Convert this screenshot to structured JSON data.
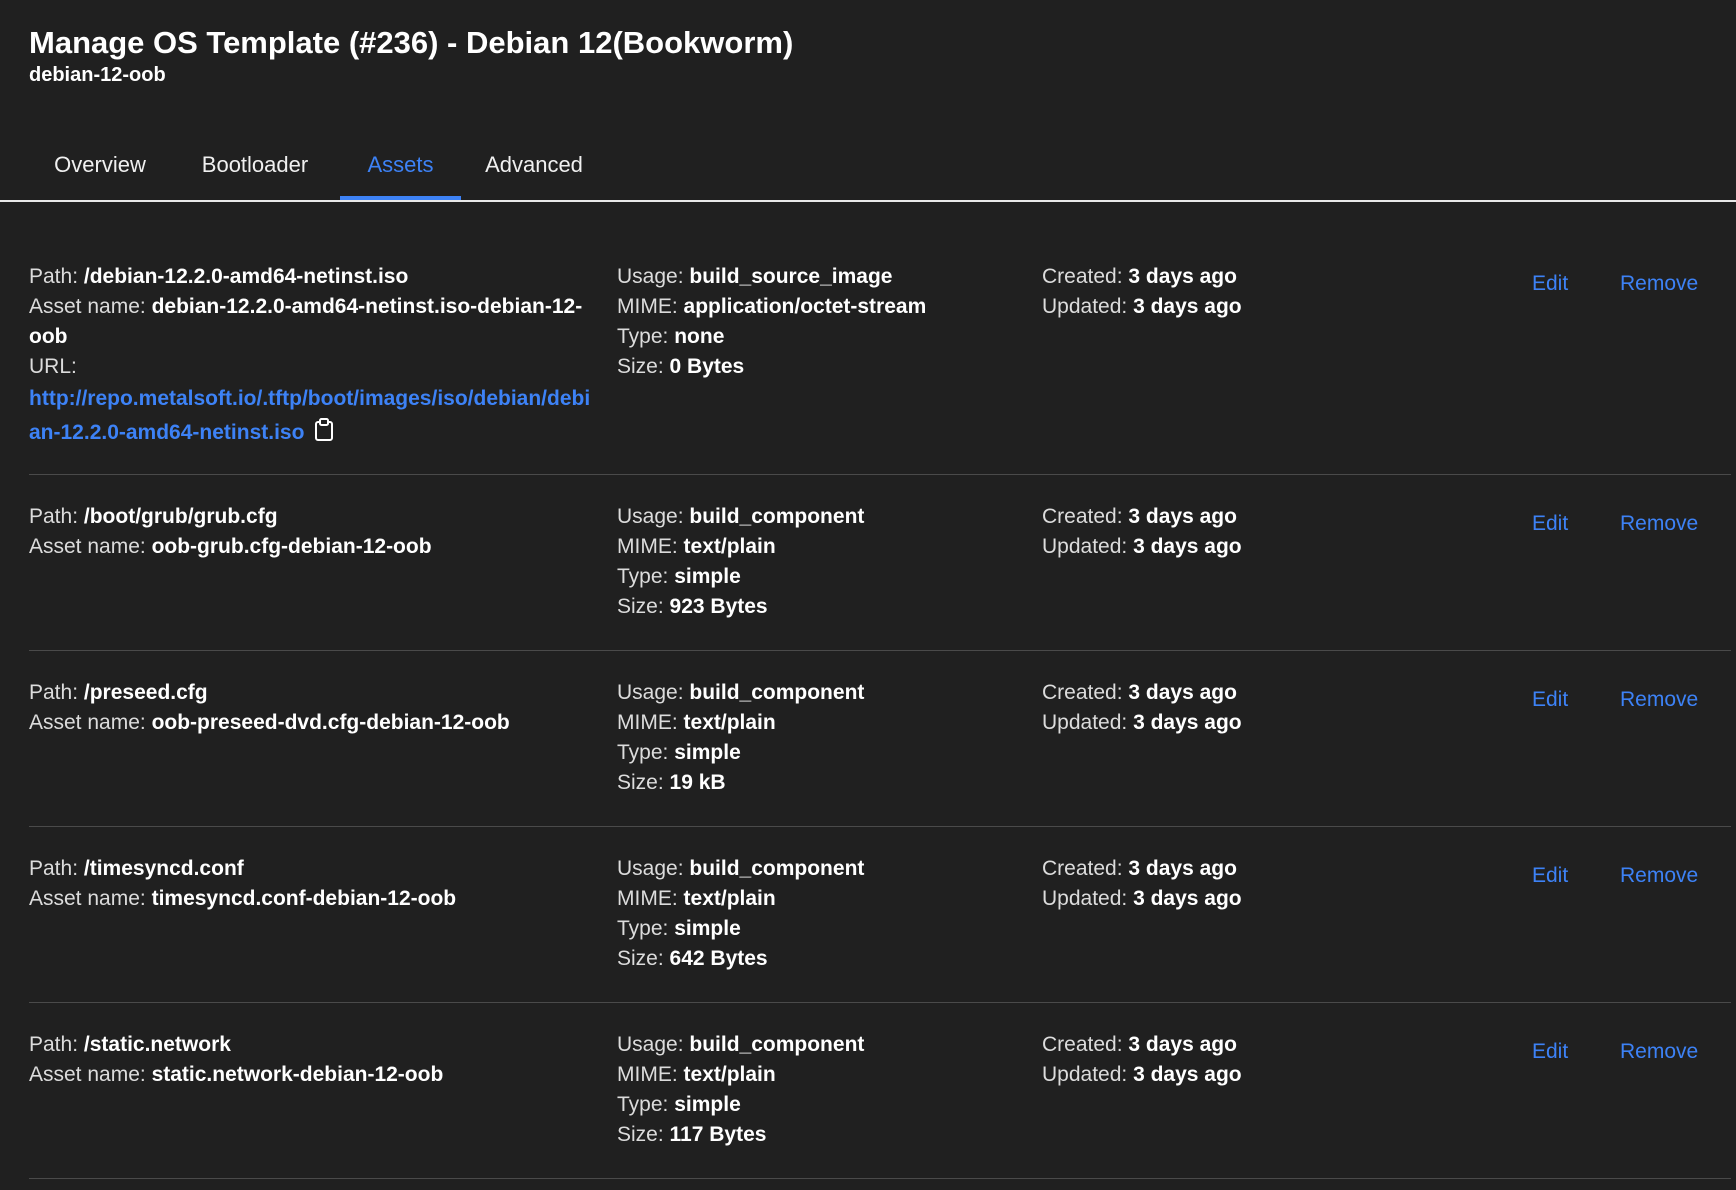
{
  "header": {
    "title": "Manage OS Template (#236) - Debian 12(Bookworm)",
    "subtitle": "debian-12-oob"
  },
  "tabs": [
    {
      "label": "Overview",
      "active": false
    },
    {
      "label": "Bootloader",
      "active": false
    },
    {
      "label": "Assets",
      "active": true
    },
    {
      "label": "Advanced",
      "active": false
    }
  ],
  "labels": {
    "path": "Path:",
    "asset_name": "Asset name:",
    "url": "URL:",
    "usage": "Usage:",
    "mime": "MIME:",
    "type": "Type:",
    "size": "Size:",
    "created": "Created:",
    "updated": "Updated:",
    "edit": "Edit",
    "remove": "Remove"
  },
  "assets": [
    {
      "path": "/debian-12.2.0-amd64-netinst.iso",
      "asset_name": "debian-12.2.0-amd64-netinst.iso-debian-12-oob",
      "url": "http://repo.metalsoft.io/.tftp/boot/images/iso/debian/debian-12.2.0-amd64-netinst.iso",
      "usage": "build_source_image",
      "mime": "application/octet-stream",
      "type": "none",
      "size": "0 Bytes",
      "created": "3 days ago",
      "updated": "3 days ago"
    },
    {
      "path": "/boot/grub/grub.cfg",
      "asset_name": "oob-grub.cfg-debian-12-oob",
      "usage": "build_component",
      "mime": "text/plain",
      "type": "simple",
      "size": "923 Bytes",
      "created": "3 days ago",
      "updated": "3 days ago"
    },
    {
      "path": "/preseed.cfg",
      "asset_name": "oob-preseed-dvd.cfg-debian-12-oob",
      "usage": "build_component",
      "mime": "text/plain",
      "type": "simple",
      "size": "19 kB",
      "created": "3 days ago",
      "updated": "3 days ago"
    },
    {
      "path": "/timesyncd.conf",
      "asset_name": "timesyncd.conf-debian-12-oob",
      "usage": "build_component",
      "mime": "text/plain",
      "type": "simple",
      "size": "642 Bytes",
      "created": "3 days ago",
      "updated": "3 days ago"
    },
    {
      "path": "/static.network",
      "asset_name": "static.network-debian-12-oob",
      "usage": "build_component",
      "mime": "text/plain",
      "type": "simple",
      "size": "117 Bytes",
      "created": "3 days ago",
      "updated": "3 days ago"
    }
  ]
}
